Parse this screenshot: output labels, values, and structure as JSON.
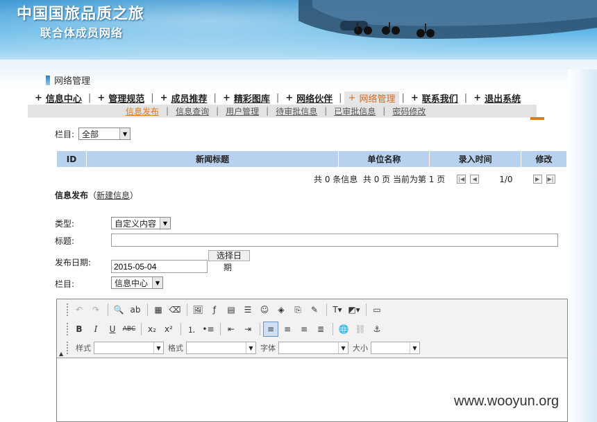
{
  "banner": {
    "title": "中国国旅品质之旅",
    "subtitle": "联合体成员网络"
  },
  "page_heading": "网络管理",
  "main_nav": [
    {
      "label": "信息中心",
      "active": false
    },
    {
      "label": "管理规范",
      "active": false
    },
    {
      "label": "成员推荐",
      "active": false
    },
    {
      "label": "精彩图库",
      "active": false
    },
    {
      "label": "网络伙伴",
      "active": false
    },
    {
      "label": "网络管理",
      "active": true
    },
    {
      "label": "联系我们",
      "active": false
    },
    {
      "label": "退出系统",
      "active": false
    }
  ],
  "sub_nav": [
    "信息发布",
    "信息查询",
    "用户管理",
    "待审批信息",
    "已审批信息",
    "密码修改"
  ],
  "filter": {
    "label": "栏目:",
    "value": "全部"
  },
  "table": {
    "headers": [
      "ID",
      "新闻标题",
      "单位名称",
      "录入时间",
      "修改"
    ]
  },
  "pager": {
    "text": "共 0 条信息  共 0 页 当前为第 1 页",
    "position": "1/0"
  },
  "section": {
    "title": "信息发布",
    "link": "新建信息"
  },
  "form": {
    "type_label": "类型:",
    "type_value": "自定义内容",
    "title_label": "标题:",
    "title_value": "",
    "date_label": "发布日期:",
    "date_value": "2015-05-04",
    "date_button_line1": "选择日",
    "date_button_line2": "期",
    "column_label": "栏目:",
    "column_value": "信息中心"
  },
  "editor": {
    "style_label": "样式",
    "format_label": "格式",
    "font_label": "字体",
    "size_label": "大小"
  },
  "watermark": "www.wooyun.org"
}
